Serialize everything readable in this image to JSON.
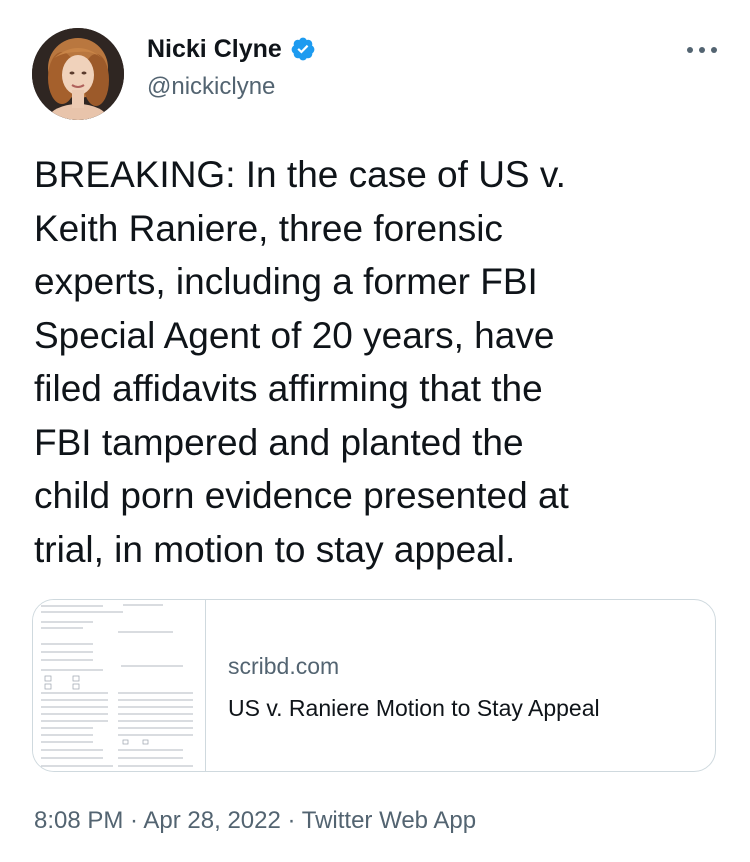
{
  "author": {
    "name": "Nicki Clyne",
    "handle": "@nickiclyne",
    "verified": true,
    "avatar_icon": "profile-photo"
  },
  "more_icon": "ellipsis-icon",
  "tweet": {
    "lines": [
      "BREAKING: In the case of US v.",
      "Keith Raniere, three forensic",
      "experts, including a former FBI",
      "Special Agent of 20 years, have",
      "filed affidavits affirming that the",
      "FBI tampered and planted the",
      "child porn evidence presented at",
      "trial, in motion to stay appeal."
    ]
  },
  "link_card": {
    "domain": "scribd.com",
    "title": "US v. Raniere Motion to Stay Appeal",
    "thumbnail_icon": "document-thumbnail"
  },
  "meta": {
    "time": "8:08 PM",
    "separator": " · ",
    "date": "Apr 28, 2022",
    "source": "Twitter Web App"
  },
  "colors": {
    "text": "#0f1419",
    "secondary": "#536471",
    "verified_blue": "#1d9bf0",
    "border": "#cfd9de"
  }
}
